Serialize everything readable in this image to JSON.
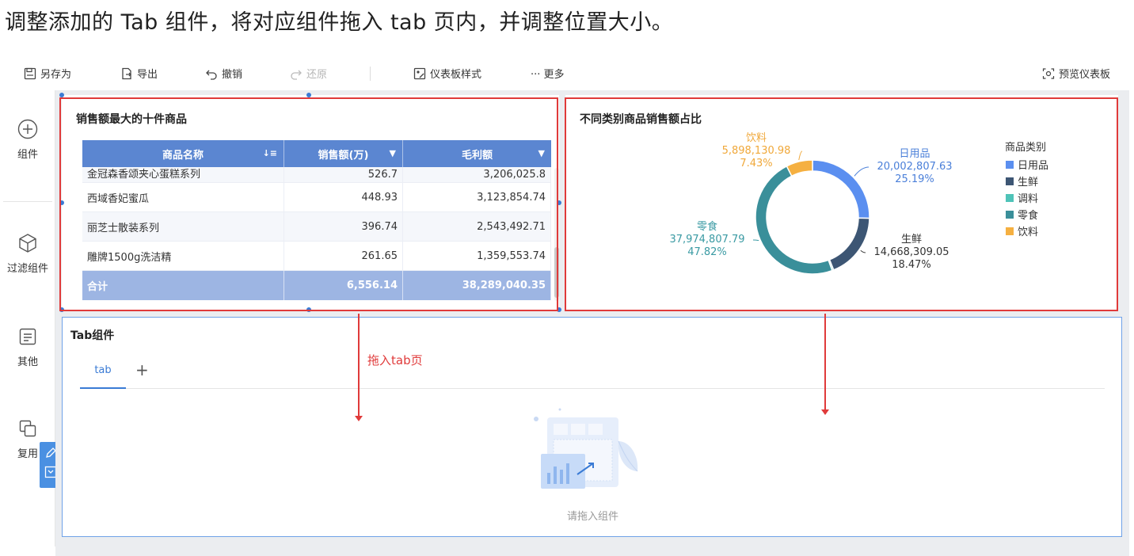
{
  "instruction": "调整添加的 Tab 组件，将对应组件拖入 tab 页内，并调整位置大小。",
  "toolbar": {
    "save_as": "另存为",
    "export": "导出",
    "undo": "撤销",
    "redo": "还原",
    "dashboard_style": "仪表板样式",
    "more": "··· 更多",
    "preview": "预览仪表板"
  },
  "left_panel": {
    "items": [
      {
        "label": "组件",
        "icon": "plus-circle-icon"
      },
      {
        "label": "过滤组件",
        "icon": "cube-icon"
      },
      {
        "label": "其他",
        "icon": "note-icon"
      },
      {
        "label": "复用",
        "icon": "copy-icon"
      }
    ]
  },
  "table_card": {
    "title": "销售额最大的十件商品",
    "headers": [
      "商品名称",
      "销售额(万)",
      "毛利额"
    ],
    "rows": [
      {
        "name": "金冠森香颂夹心蛋糕系列",
        "sales": "526.7",
        "profit": "3,206,025.8"
      },
      {
        "name": "西域香妃蜜瓜",
        "sales": "448.93",
        "profit": "3,123,854.74"
      },
      {
        "name": "丽芝士散装系列",
        "sales": "396.74",
        "profit": "2,543,492.71"
      },
      {
        "name": "雕牌1500g洗洁精",
        "sales": "261.65",
        "profit": "1,359,553.74"
      }
    ],
    "total": {
      "name": "合计",
      "sales": "6,556.14",
      "profit": "38,289,040.35"
    }
  },
  "chart_card": {
    "title": "不同类别商品销售额占比"
  },
  "chart_data": {
    "type": "pie",
    "title": "不同类别商品销售额占比",
    "legend_title": "商品类别",
    "legend_position": "right",
    "categories": [
      "日用品",
      "生鲜",
      "调料",
      "零食",
      "饮料"
    ],
    "values": [
      20002807.63,
      14668309.05,
      340000,
      37974807.79,
      5898130.98
    ],
    "value_labels": [
      "20,002,807.63",
      "14,668,309.05",
      "",
      "37,974,807.79",
      "5,898,130.98"
    ],
    "percent_labels": [
      "25.19%",
      "18.47%",
      "",
      "47.82%",
      "7.43%"
    ],
    "colors": [
      "#5b8ff0",
      "#3d5674",
      "#4fc3b8",
      "#3a8f9a",
      "#f5b041"
    ],
    "label_colors": [
      "#4a7fd9",
      "#333333",
      "#4fc3b8",
      "#3a9aa3",
      "#f0a83a"
    ],
    "donut": true
  },
  "tab_component": {
    "title": "Tab组件",
    "tab_label": "tab",
    "add_symbol": "+",
    "empty_hint": "请拖入组件"
  },
  "annotation": {
    "drag_text": "拖入tab页"
  }
}
